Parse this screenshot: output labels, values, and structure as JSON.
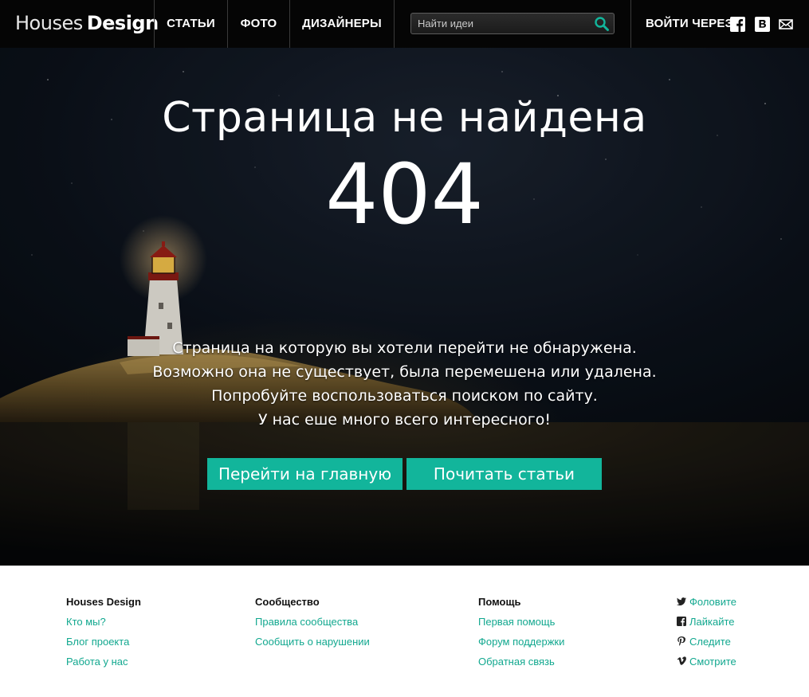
{
  "header": {
    "logo_light": "Houses",
    "logo_bold": "Design",
    "nav": [
      "СТАТЬИ",
      "ФОТО",
      "ДИЗАЙНЕРЫ"
    ],
    "search_placeholder": "Найти идеи",
    "login_label": "ВОЙТИ ЧЕРЕЗ",
    "social_icons": [
      "facebook-icon",
      "vk-icon",
      "mail-icon"
    ]
  },
  "hero": {
    "title": "Страница не найдена",
    "code": "404",
    "message_lines": [
      "Страница на которую вы хотели перейти не обнаружена.",
      "Возможно она не существует, была перемешена или удалена.",
      "Попробуйте воспользоваться поиском по сайту.",
      "У нас еше много всего интересного!"
    ],
    "buttons": [
      "Перейти на главную",
      "Почитать статьи"
    ]
  },
  "footer": {
    "columns": [
      {
        "heading": "Houses Design",
        "links": [
          "Кто мы?",
          "Блог проекта",
          "Работа у нас"
        ]
      },
      {
        "heading": "Сообщество",
        "links": [
          "Правила сообщества",
          "Сообщить о нарушении"
        ]
      },
      {
        "heading": "Помощь",
        "links": [
          "Первая помощь",
          "Форум поддержки",
          "Обратная связь"
        ]
      }
    ],
    "social": [
      {
        "icon": "twitter-icon",
        "label": "Фоловите"
      },
      {
        "icon": "facebook-icon",
        "label": "Лайкайте"
      },
      {
        "icon": "pinterest-icon",
        "label": "Следите"
      },
      {
        "icon": "vimeo-icon",
        "label": "Смотрите"
      }
    ]
  },
  "colors": {
    "accent": "#12b59b",
    "link": "#12a88f",
    "header_bg": "#050505"
  }
}
